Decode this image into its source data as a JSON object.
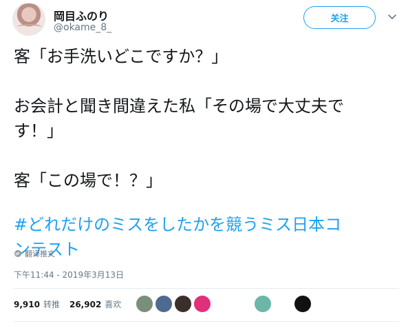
{
  "user": {
    "display_name": "岡目ふのり",
    "handle": "@okame_8_"
  },
  "follow_button": {
    "label": "关注"
  },
  "tweet": {
    "paragraphs": [
      [
        "客「お手洗いどこですか？」"
      ],
      [
        "お会計と聞き間違えた私「その場で大丈夫で",
        "す！」"
      ],
      [
        "客「この場で！？」"
      ]
    ],
    "hashtag_lines": [
      "#どれだけのミスをしたかを競うミス日本コ",
      "ンテスト"
    ]
  },
  "translate_label": "翻译推文",
  "timestamp": "下午11:44 - 2019年3月13日",
  "stats": {
    "retweets_count": "9,910",
    "retweets_label": "转推",
    "likes_count": "26,902",
    "likes_label": "喜欢"
  },
  "colors": {
    "accent": "#1da1f2",
    "text": "#14171a",
    "secondary": "#657786",
    "divider": "#e6ecf0"
  },
  "liker_avatars": [
    {
      "name": "liker-1",
      "color": "#7a8f7a"
    },
    {
      "name": "liker-2",
      "color": "#4f6a8f"
    },
    {
      "name": "liker-3",
      "color": "#3a2f2a"
    },
    {
      "name": "liker-4",
      "color": "#e0307a"
    },
    {
      "name": "liker-5",
      "color": "#6ab7a7"
    },
    {
      "name": "liker-6",
      "color": "#111111"
    }
  ]
}
